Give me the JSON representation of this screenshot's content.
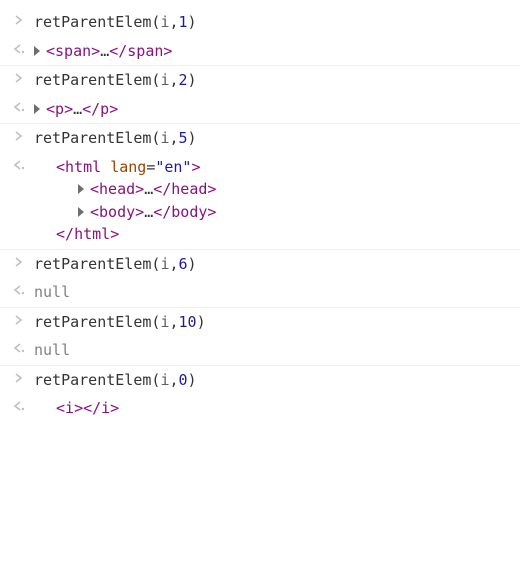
{
  "entries": [
    {
      "input": {
        "fn": "retParentElem",
        "arg": "i",
        "num": "1"
      },
      "output": {
        "type": "node-collapsed",
        "tag": "span"
      }
    },
    {
      "input": {
        "fn": "retParentElem",
        "arg": "i",
        "num": "2"
      },
      "output": {
        "type": "node-collapsed",
        "tag": "p"
      }
    },
    {
      "input": {
        "fn": "retParentElem",
        "arg": "i",
        "num": "5"
      },
      "output": {
        "type": "html-block",
        "open_tag": "html",
        "attr_name": "lang",
        "attr_value": "\"en\"",
        "children": [
          {
            "tag": "head"
          },
          {
            "tag": "body"
          }
        ],
        "close_tag": "html"
      }
    },
    {
      "input": {
        "fn": "retParentElem",
        "arg": "i",
        "num": "6"
      },
      "output": {
        "type": "null",
        "text": "null"
      }
    },
    {
      "input": {
        "fn": "retParentElem",
        "arg": "i",
        "num": "10"
      },
      "output": {
        "type": "null",
        "text": "null"
      }
    },
    {
      "input": {
        "fn": "retParentElem",
        "arg": "i",
        "num": "0"
      },
      "output": {
        "type": "empty-tag",
        "tag": "i"
      }
    }
  ]
}
